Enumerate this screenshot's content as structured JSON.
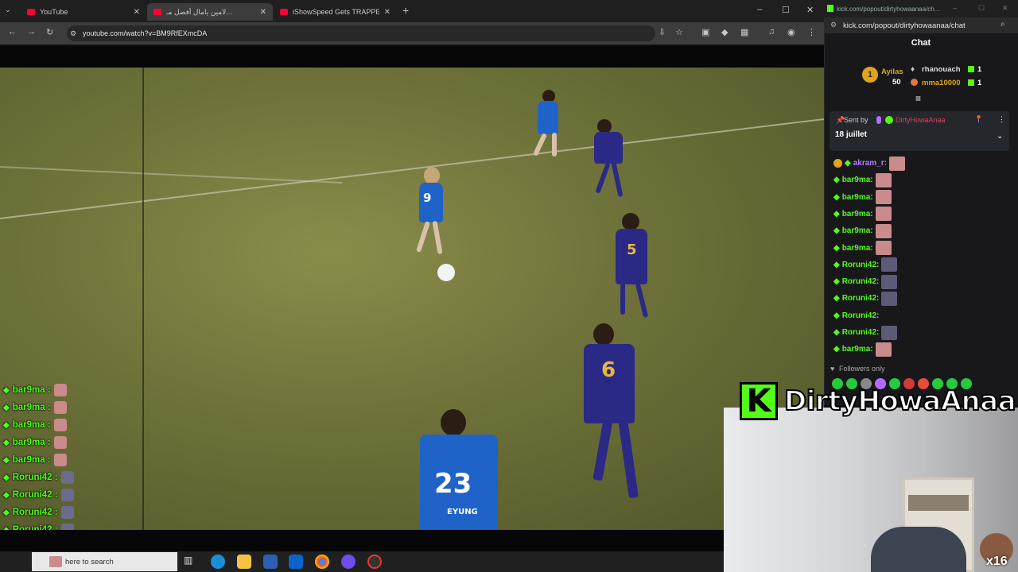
{
  "browser": {
    "tabs": [
      {
        "title": "YouTube",
        "active": false
      },
      {
        "title": "لامين يامال أفضل مـ...",
        "active": true
      },
      {
        "title": "iShowSpeed Gets TRAPPED in ...",
        "active": false
      }
    ],
    "url": "youtube.com/watch?v=BM9RfEXmcDA"
  },
  "jerseys": {
    "n1": "9",
    "n2": "5",
    "n3": "6",
    "n4": "23",
    "n4_name": "EYUNG"
  },
  "overlay_chat": [
    {
      "user": "bar9ma :",
      "emote": "pink"
    },
    {
      "user": "bar9ma :",
      "emote": "pink"
    },
    {
      "user": "bar9ma :",
      "emote": "pink"
    },
    {
      "user": "bar9ma :",
      "emote": "pink"
    },
    {
      "user": "bar9ma :",
      "emote": "pink"
    },
    {
      "user": "Roruni42 :",
      "emote": "blue"
    },
    {
      "user": "Roruni42 :",
      "emote": "blue"
    },
    {
      "user": "Roruni42 :",
      "emote": "blue"
    },
    {
      "user": "Roruni42 :",
      "emote": "blue"
    },
    {
      "user": "Roruni42 :",
      "emote": "blue"
    },
    {
      "user": "bar9ma :",
      "emote": "pink"
    }
  ],
  "taskbar": {
    "search_placeholder": "here to search"
  },
  "chat": {
    "window_url_title": "kick.com/popout/dirtyhowaanaa/ch...",
    "url": "kick.com/popout/dirtyhowaanaa/chat",
    "header": "Chat",
    "leaderboard": {
      "first": {
        "rank": "1",
        "name": "Ayilas",
        "count": "50"
      },
      "others": [
        {
          "name": "rhanouach",
          "count": "1"
        },
        {
          "name": "mma10000",
          "count": "1"
        }
      ]
    },
    "pinned": {
      "sent_by": "Sent by",
      "author": "DirtyHowaAnaa",
      "date": "18 juillet"
    },
    "messages": [
      {
        "user": "akram_r:",
        "color": "#b07cff",
        "emote": "pink"
      },
      {
        "user": "bar9ma:",
        "color": "#53fc18",
        "emote": "pink"
      },
      {
        "user": "bar9ma:",
        "color": "#53fc18",
        "emote": "pink"
      },
      {
        "user": "bar9ma:",
        "color": "#53fc18",
        "emote": "pink"
      },
      {
        "user": "bar9ma:",
        "color": "#53fc18",
        "emote": "pink"
      },
      {
        "user": "bar9ma:",
        "color": "#53fc18",
        "emote": "pink"
      },
      {
        "user": "Roruni42:",
        "color": "#53fc18",
        "emote": "blue"
      },
      {
        "user": "Roruni42:",
        "color": "#53fc18",
        "emote": "blue"
      },
      {
        "user": "Roruni42:",
        "color": "#53fc18",
        "emote": "blue"
      },
      {
        "user": "Roruni42:",
        "color": "#53fc18",
        "emote": "none"
      },
      {
        "user": "Roruni42:",
        "color": "#53fc18",
        "emote": "blue"
      },
      {
        "user": "bar9ma:",
        "color": "#53fc18",
        "emote": "pink"
      }
    ],
    "mode": "Followers only"
  },
  "brand": {
    "logo": "K",
    "name": "DirtyHowaAnaa",
    "color": "#53fc18"
  },
  "webcam": {
    "multiplier": "x16"
  }
}
